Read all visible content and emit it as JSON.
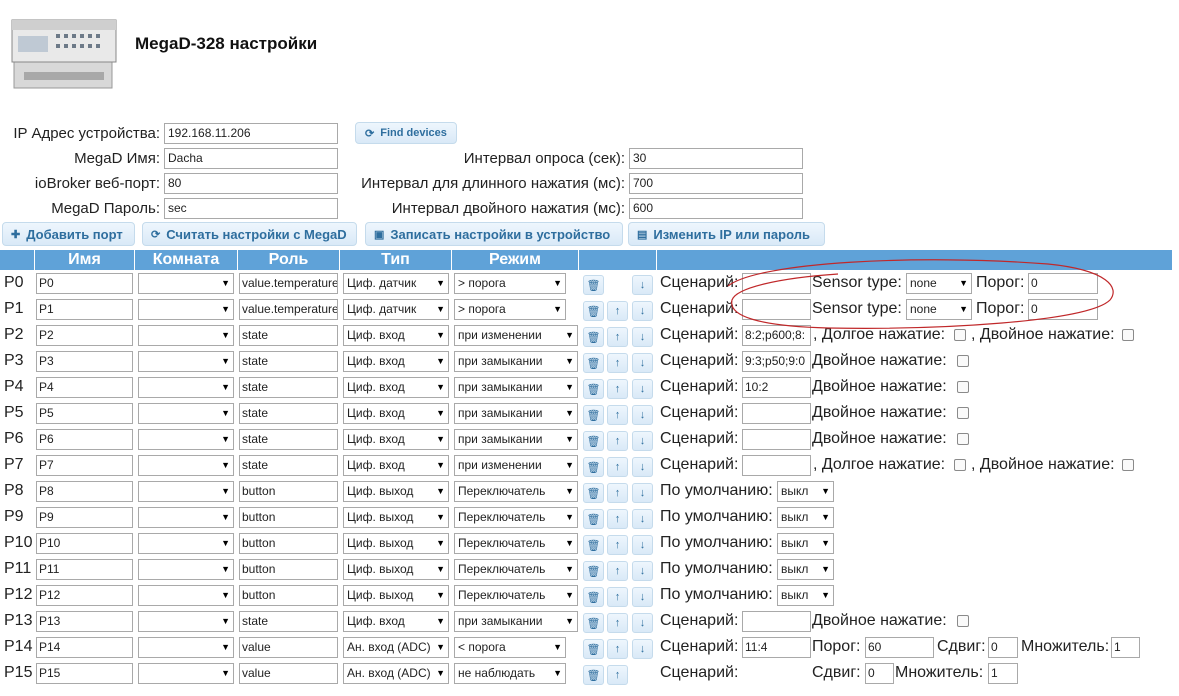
{
  "title": "MegaD-328 настройки",
  "form": {
    "ip_label": "IP Адрес устройства:",
    "ip_value": "192.168.11.206",
    "find_devices": "Find devices",
    "name_label": "MegaD Имя:",
    "name_value": "Dacha",
    "port_label": "ioBroker веб-порт:",
    "port_value": "80",
    "password_label": "MegaD Пароль:",
    "password_value": "sec",
    "poll_label": "Интервал опроса (сек):",
    "poll_value": "30",
    "long_label": "Интервал для длинного нажатия (мс):",
    "long_value": "700",
    "double_label": "Интервал двойного нажатия (мс):",
    "double_value": "600"
  },
  "toolbar": {
    "add_port": "Добавить порт",
    "read_settings": "Считать настройки с MegaD",
    "write_settings": "Записать настройки в устройство",
    "change_ip": "Изменить IP или пароль"
  },
  "table": {
    "headers": [
      "Имя",
      "Комната",
      "Роль",
      "Тип",
      "Режим"
    ]
  },
  "labels": {
    "scenario": "Сценарий:",
    "sensor_type": "Sensor type:",
    "threshold": "Порог:",
    "long_press": ", Долгое нажатие:",
    "double_press_comma": ", Двойное нажатие:",
    "double_press": "Двойное нажатие:",
    "default": "По умолчанию:",
    "shift": "Сдвиг:",
    "multiplier": "Множитель:"
  },
  "ports": [
    {
      "label": "P0",
      "name": "P0",
      "role": "value.temperature",
      "type": "Циф. датчик",
      "mode": "> порога",
      "scenario": "",
      "sensor_type": "none",
      "threshold": "0"
    },
    {
      "label": "P1",
      "name": "P1",
      "role": "value.temperature",
      "type": "Циф. датчик",
      "mode": "> порога",
      "scenario": "",
      "sensor_type": "none",
      "threshold": "0"
    },
    {
      "label": "P2",
      "name": "P2",
      "role": "state",
      "type": "Циф. вход",
      "mode": "при изменении",
      "scenario": "8:2;p600;8:"
    },
    {
      "label": "P3",
      "name": "P3",
      "role": "state",
      "type": "Циф. вход",
      "mode": "при замыкании",
      "scenario": "9:3;p50;9:0"
    },
    {
      "label": "P4",
      "name": "P4",
      "role": "state",
      "type": "Циф. вход",
      "mode": "при замыкании",
      "scenario": "10:2"
    },
    {
      "label": "P5",
      "name": "P5",
      "role": "state",
      "type": "Циф. вход",
      "mode": "при замыкании",
      "scenario": ""
    },
    {
      "label": "P6",
      "name": "P6",
      "role": "state",
      "type": "Циф. вход",
      "mode": "при замыкании",
      "scenario": ""
    },
    {
      "label": "P7",
      "name": "P7",
      "role": "state",
      "type": "Циф. вход",
      "mode": "при изменении",
      "scenario": ""
    },
    {
      "label": "P8",
      "name": "P8",
      "role": "button",
      "type": "Циф. выход",
      "mode": "Переключатель",
      "default": "выкл"
    },
    {
      "label": "P9",
      "name": "P9",
      "role": "button",
      "type": "Циф. выход",
      "mode": "Переключатель",
      "default": "выкл"
    },
    {
      "label": "P10",
      "name": "P10",
      "role": "button",
      "type": "Циф. выход",
      "mode": "Переключатель",
      "default": "выкл"
    },
    {
      "label": "P11",
      "name": "P11",
      "role": "button",
      "type": "Циф. выход",
      "mode": "Переключатель",
      "default": "выкл"
    },
    {
      "label": "P12",
      "name": "P12",
      "role": "button",
      "type": "Циф. выход",
      "mode": "Переключатель",
      "default": "выкл"
    },
    {
      "label": "P13",
      "name": "P13",
      "role": "state",
      "type": "Циф. вход",
      "mode": "при замыкании",
      "scenario": ""
    },
    {
      "label": "P14",
      "name": "P14",
      "role": "value",
      "type": "Ан. вход (ADC)",
      "mode": "< порога",
      "scenario": "11:4",
      "threshold": "60",
      "shift": "0",
      "multiplier": "1"
    },
    {
      "label": "P15",
      "name": "P15",
      "role": "value",
      "type": "Ан. вход (ADC)",
      "mode": "не наблюдать",
      "shift": "0",
      "multiplier": "1"
    }
  ],
  "icons": {
    "delete": "trash-icon",
    "up": "arrow-up-icon",
    "down": "arrow-down-icon",
    "refresh": "refresh-icon",
    "plus": "plus-icon",
    "save": "save-icon",
    "edit": "edit-icon"
  },
  "colors": {
    "header_bg": "#5fa2d8",
    "button_text": "#2e6e9e",
    "annotation": "#c0282a"
  }
}
